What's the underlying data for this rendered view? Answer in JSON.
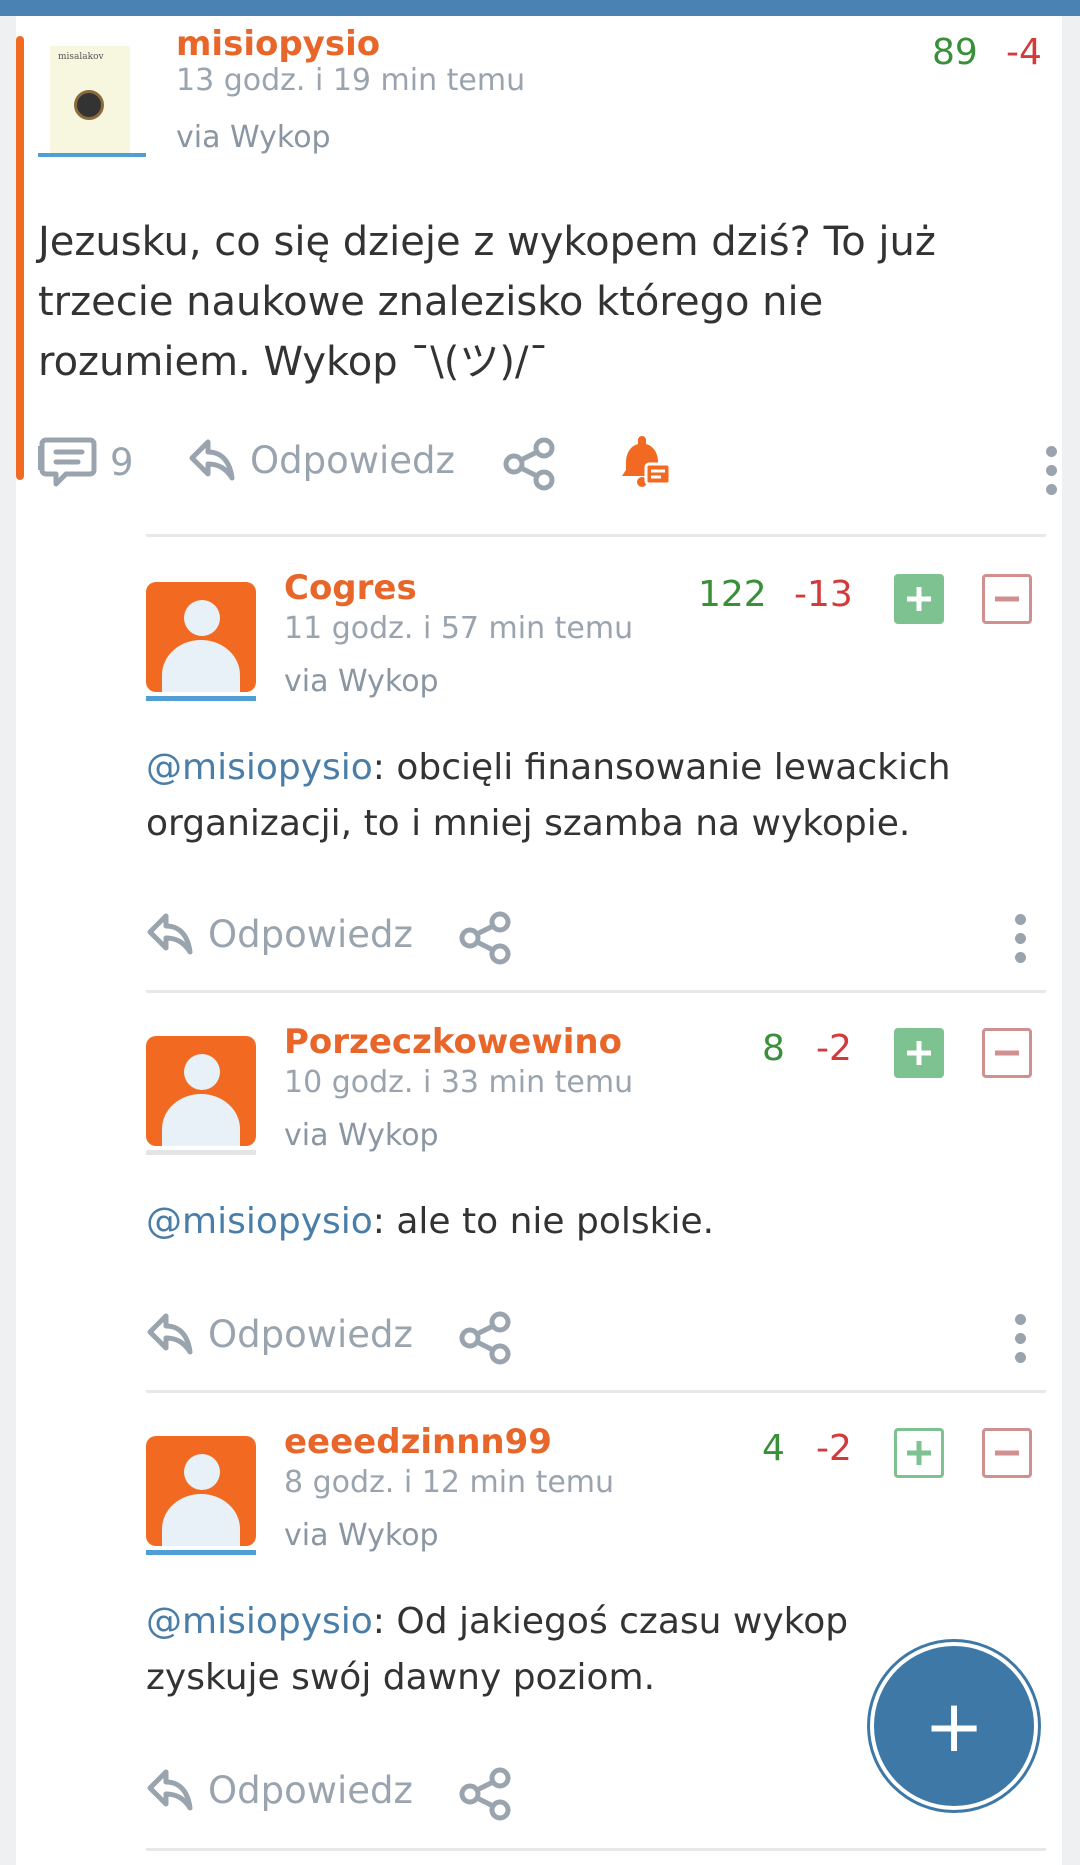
{
  "main": {
    "author": "misiopysio",
    "avatar_caption": "misalakov",
    "time": "13 godz. i 19 min temu",
    "via": "via Wykop",
    "score_plus": "89",
    "score_minus": "-4",
    "text": "Jezusku, co się dzieje z wykopem dziś? To już trzecie naukowe znalezisko którego nie rozumiem. Wykop ¯\\(ツ)/¯",
    "comment_count": "9",
    "reply_label": "Odpowiedz"
  },
  "replies": [
    {
      "author": "Cogres",
      "time": "11 godz. i 57 min temu",
      "via": "via Wykop",
      "score_plus": "122",
      "score_minus": "-13",
      "mention": "@misiopysio",
      "text": ": obcięli finansowanie lewackich organizacji, to i mniej szamba na wykopie.",
      "reply_label": "Odpowiedz"
    },
    {
      "author": "Porzeczkowewino",
      "time": "10 godz. i 33 min temu",
      "via": "via Wykop",
      "score_plus": "8",
      "score_minus": "-2",
      "mention": "@misiopysio",
      "text": ": ale to nie polskie.",
      "reply_label": "Odpowiedz"
    },
    {
      "author": "eeeedzinnn99",
      "time": "8 godz. i 12 min temu",
      "via": "via Wykop",
      "score_plus": "4",
      "score_minus": "-2",
      "mention": "@misiopysio",
      "text": ": Od jakiegoś czasu wykop zyskuje swój dawny poziom.",
      "reply_label": "Odpowiedz"
    }
  ],
  "fab_label": "+",
  "colors": {
    "accent_orange": "#f26a22",
    "plus_green": "#3a8f3a",
    "minus_red": "#d33a3a",
    "link_blue": "#4a7ea8",
    "fab_blue": "#3d78a6"
  }
}
